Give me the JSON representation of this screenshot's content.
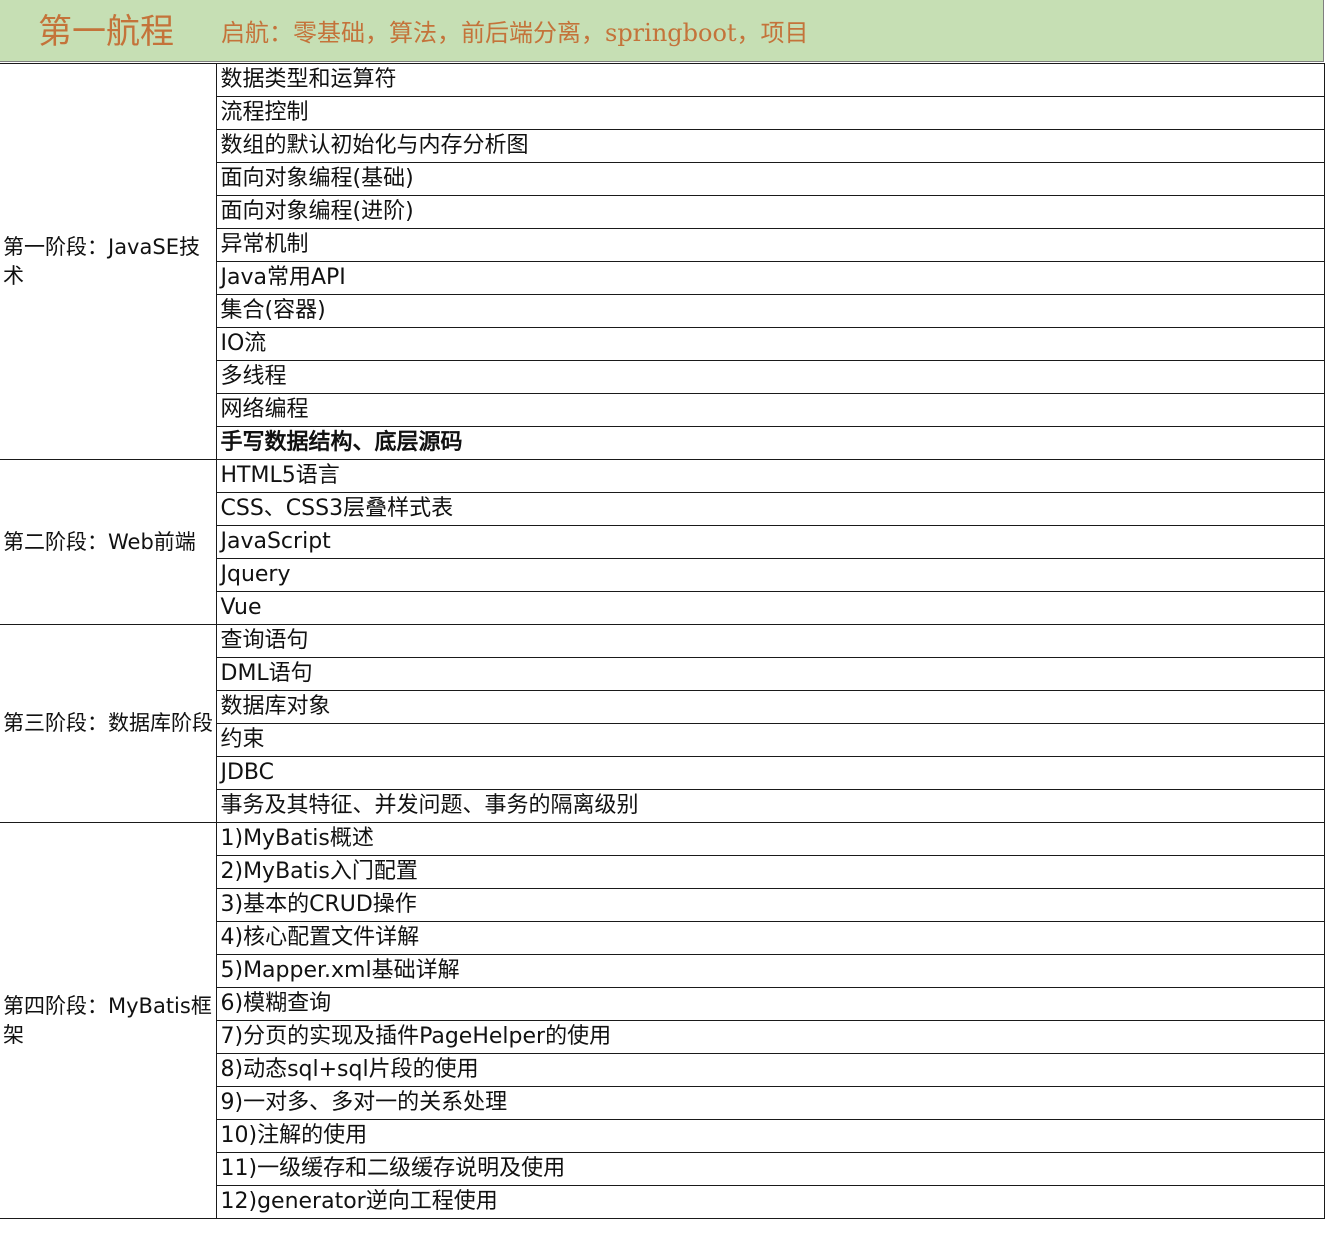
{
  "header": {
    "title": "第一航程",
    "subtitle": "启航：零基础，算法，前后端分离，springboot，项目"
  },
  "stages": [
    {
      "label": "第一阶段：JavaSE技术",
      "topics": [
        "数据类型和运算符",
        "流程控制",
        "数组的默认初始化与内存分析图",
        "面向对象编程(基础)",
        "面向对象编程(进阶)",
        "异常机制",
        "Java常用API",
        "集合(容器)",
        "IO流",
        "多线程",
        "网络编程",
        "手写数据结构、底层源码"
      ]
    },
    {
      "label": "第二阶段：Web前端",
      "topics": [
        "HTML5语言",
        "CSS、CSS3层叠样式表",
        "JavaScript",
        "Jquery",
        "Vue"
      ]
    },
    {
      "label": "第三阶段：数据库阶段",
      "topics": [
        "查询语句",
        "DML语句",
        "数据库对象",
        "约束",
        "JDBC",
        "事务及其特征、并发问题、事务的隔离级别"
      ]
    },
    {
      "label": "第四阶段：MyBatis框架",
      "topics": [
        "1)MyBatis概述",
        "2)MyBatis入门配置",
        "3)基本的CRUD操作",
        "4)核心配置文件详解",
        "5)Mapper.xml基础详解",
        "6)模糊查询",
        "7)分页的实现及插件PageHelper的使用",
        "8)动态sql+sql片段的使用",
        "9)一对多、多对一的关系处理",
        "10)注解的使用",
        "11)一级缓存和二级缓存说明及使用",
        "12)generator逆向工程使用"
      ]
    }
  ],
  "colors": {
    "header_bg": "#c6dfb4",
    "header_text": "#c4733a",
    "highlight_red": "#ff0000"
  }
}
